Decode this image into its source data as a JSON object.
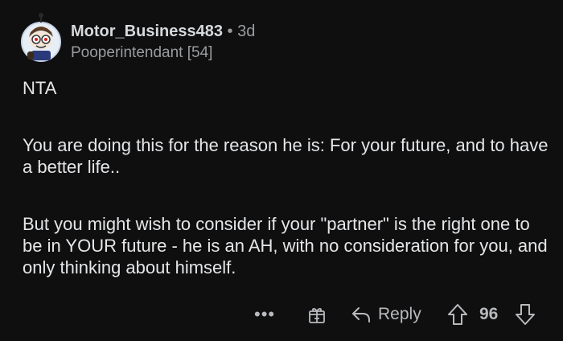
{
  "comment": {
    "author": "Motor_Business483",
    "separator": "•",
    "time": "3d",
    "flair": "Pooperintendant [54]",
    "body": [
      "NTA",
      "You are doing this for the reason he is: For your future, and to have a better life..",
      "But you might wish to consider if your \"partner\" is the right one to be in YOUR future - he is an AH, with no consideration for you, and only thinking about himself."
    ]
  },
  "actions": {
    "more_label": "•••",
    "reply_label": "Reply",
    "score": "96"
  },
  "icons": {
    "avatar": "snoo-avatar",
    "more": "more-icon",
    "gift": "award-icon",
    "reply": "reply-arrow-icon",
    "upvote": "upvote-arrow-icon",
    "downvote": "downvote-arrow-icon"
  }
}
